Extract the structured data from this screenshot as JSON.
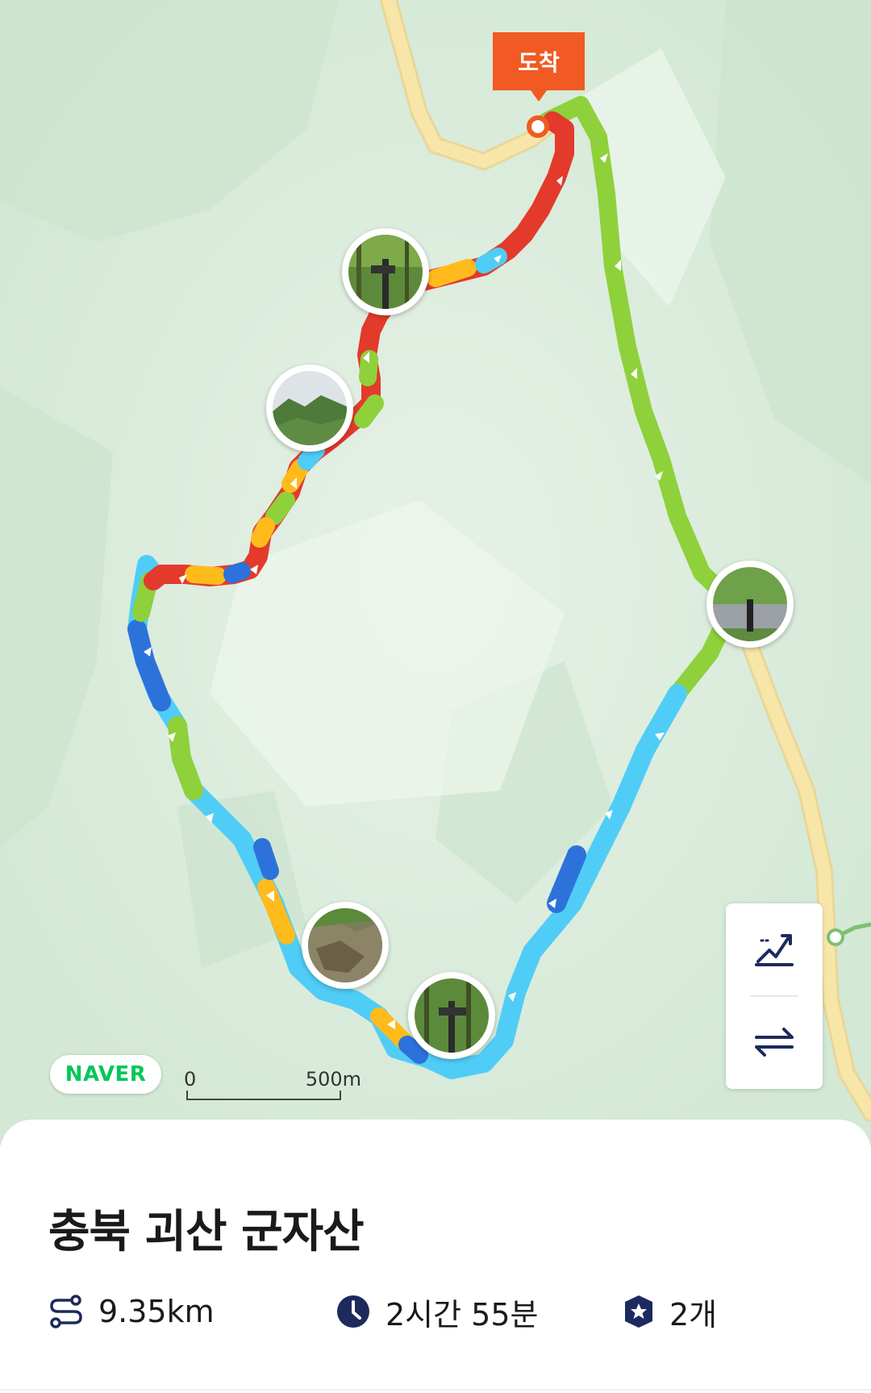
{
  "map": {
    "arrival_label": "도착",
    "brand_logo": "NAVER",
    "scale": {
      "zero": "0",
      "distance": "500m"
    },
    "colors": {
      "land": "#dfeee0",
      "road": "#f6e2a3",
      "route_green": "#8ed13b",
      "route_red": "#e33a2c",
      "route_orange": "#ffbb1c",
      "route_blue": "#2d72db",
      "route_cyan": "#4fcdf7",
      "flag": "#f15a22"
    },
    "controls": [
      {
        "icon": "elevation-profile-icon"
      },
      {
        "icon": "swap-direction-icon"
      }
    ]
  },
  "course": {
    "name": "충북 괴산 군자산",
    "stats": {
      "distance": "9.35km",
      "duration": "2시간 55분",
      "badges": "2개"
    },
    "icons": {
      "distance": "route-distance-icon",
      "duration": "clock-icon",
      "badges": "star-shield-icon"
    }
  }
}
